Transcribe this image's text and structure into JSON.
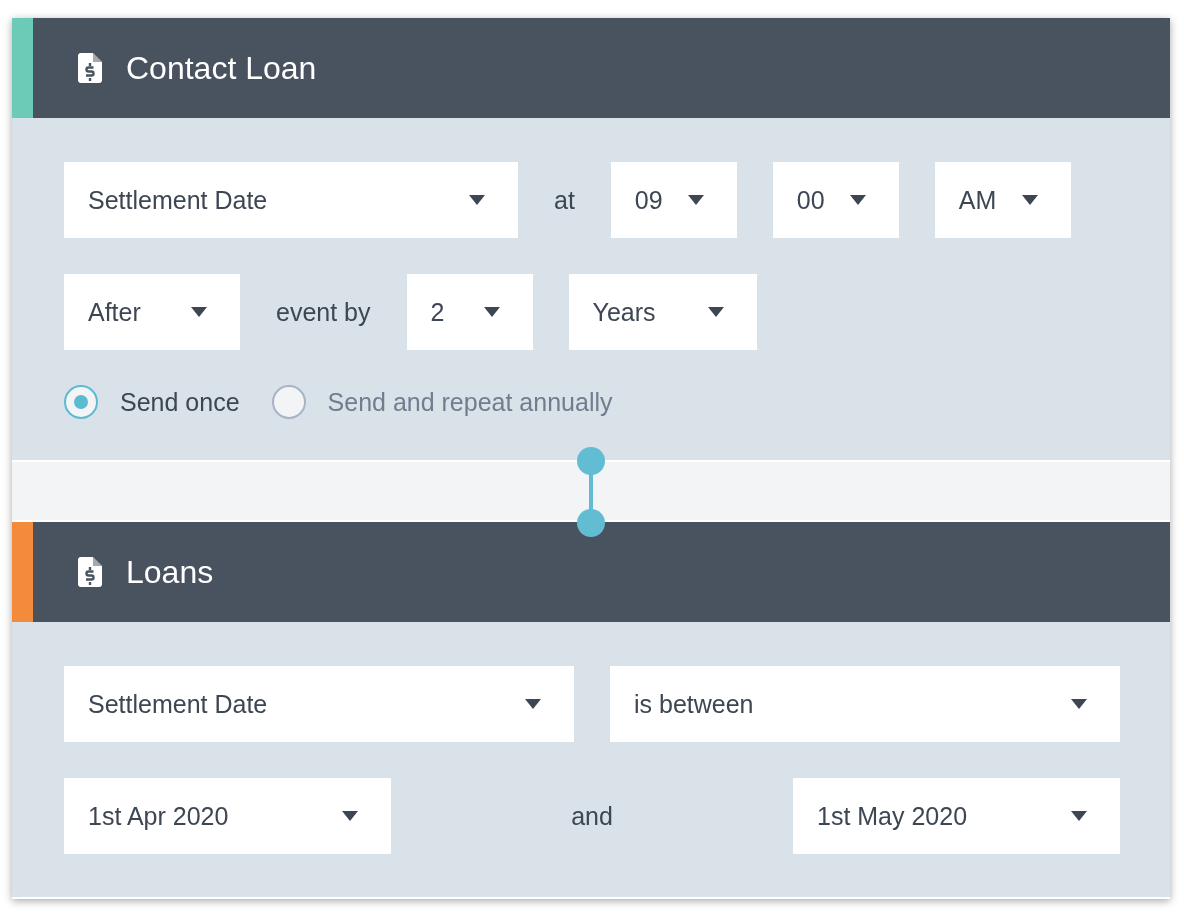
{
  "cards": [
    {
      "title": "Contact Loan",
      "color": "#6bcbb7",
      "lines": [
        {
          "fields": [
            {
              "kind": "select",
              "value": "Settlement Date"
            },
            {
              "kind": "text",
              "value": "at"
            },
            {
              "kind": "select",
              "value": "09"
            },
            {
              "kind": "select",
              "value": "00"
            },
            {
              "kind": "select",
              "value": "AM"
            }
          ]
        },
        {
          "fields": [
            {
              "kind": "select",
              "value": "After"
            },
            {
              "kind": "text",
              "value": "event by"
            },
            {
              "kind": "select",
              "value": "2"
            },
            {
              "kind": "select",
              "value": "Years"
            }
          ]
        }
      ],
      "radios": [
        {
          "label": "Send once",
          "selected": true
        },
        {
          "label": "Send and repeat annually",
          "selected": false
        }
      ]
    },
    {
      "title": "Loans",
      "color": "#f38a3c",
      "lines": [
        {
          "fields": [
            {
              "kind": "select",
              "value": "Settlement Date"
            },
            {
              "kind": "select",
              "value": "is between"
            }
          ]
        },
        {
          "fields": [
            {
              "kind": "select",
              "value": "1st Apr 2020"
            },
            {
              "kind": "text",
              "value": "and"
            },
            {
              "kind": "select",
              "value": "1st May 2020"
            }
          ]
        }
      ]
    }
  ]
}
